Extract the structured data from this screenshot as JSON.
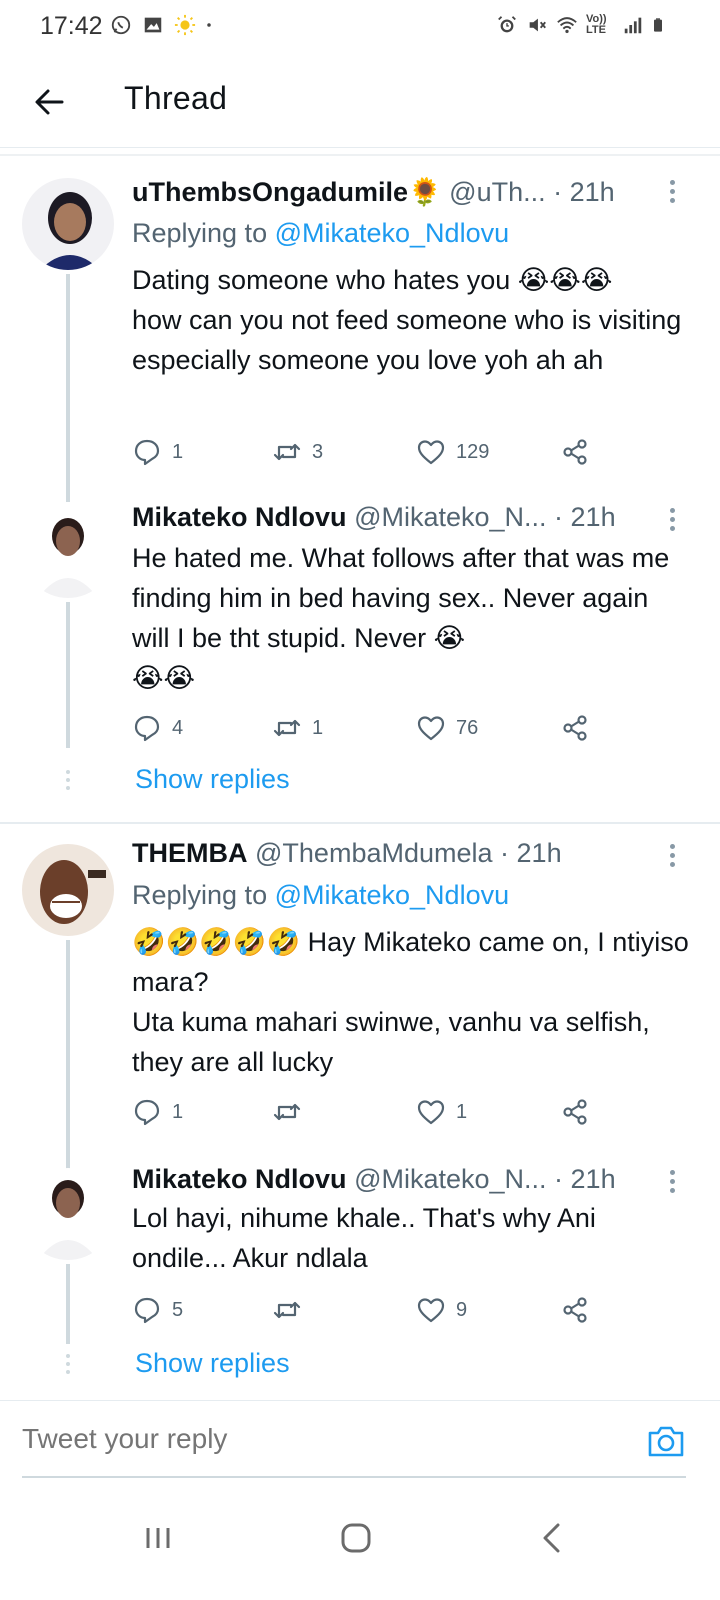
{
  "status_bar": {
    "time": "17:42",
    "left_icons": [
      "whatsapp-icon",
      "image-icon",
      "sun-icon",
      "dot-icon"
    ],
    "right_icons": [
      "alarm-icon",
      "mute-icon",
      "wifi-icon",
      "volte-icon",
      "signal-icon",
      "battery-icon"
    ],
    "volte_label": "Vo)) LTE"
  },
  "header": {
    "back_icon": "arrow-left-icon",
    "title": "Thread"
  },
  "tweets": [
    {
      "name": "uThembsOngadumile🌻",
      "handle": "@uTh...",
      "time": "· 21h",
      "replying_prefix": "Replying to ",
      "replying_to": "@Mikateko_Ndlovu",
      "text": "Dating someone who hates you 😭😭😭\nhow can you not feed someone who is visiting especially someone you love yoh ah ah",
      "replies": "1",
      "retweets": "3",
      "likes": "129"
    },
    {
      "name": "Mikateko Ndlovu",
      "handle": "@Mikateko_N...",
      "time": "· 21h",
      "text": "He hated me. What follows after that was me finding him in bed having sex.. Never again will I be tht stupid. Never 😭\n😭😭",
      "replies": "4",
      "retweets": "1",
      "likes": "76",
      "show_replies": "Show replies"
    },
    {
      "name": "THEMBA",
      "handle": "@ThembaMdumela",
      "time": "· 21h",
      "replying_prefix": "Replying to ",
      "replying_to": "@Mikateko_Ndlovu",
      "text": "🤣🤣🤣🤣🤣 Hay Mikateko came on, I ntiyiso mara?\nUta kuma mahari swinwe, vanhu va selfish, they are all lucky",
      "replies": "1",
      "retweets": "",
      "likes": "1"
    },
    {
      "name": "Mikateko Ndlovu",
      "handle": "@Mikateko_N...",
      "time": "· 21h",
      "text": "Lol hayi, nihume khale.. That's why Ani ondile... Akur ndlala",
      "replies": "5",
      "retweets": "",
      "likes": "9",
      "show_replies": "Show replies"
    }
  ],
  "reply_box": {
    "placeholder": "Tweet your reply",
    "camera_icon": "camera-icon"
  },
  "nav_bar": {
    "icons": [
      "recents-icon",
      "home-icon",
      "back-icon"
    ]
  },
  "colors": {
    "accent": "#1d9bf0",
    "text": "#0f1419",
    "secondary": "#536471",
    "thread_line": "#cfd9de"
  }
}
